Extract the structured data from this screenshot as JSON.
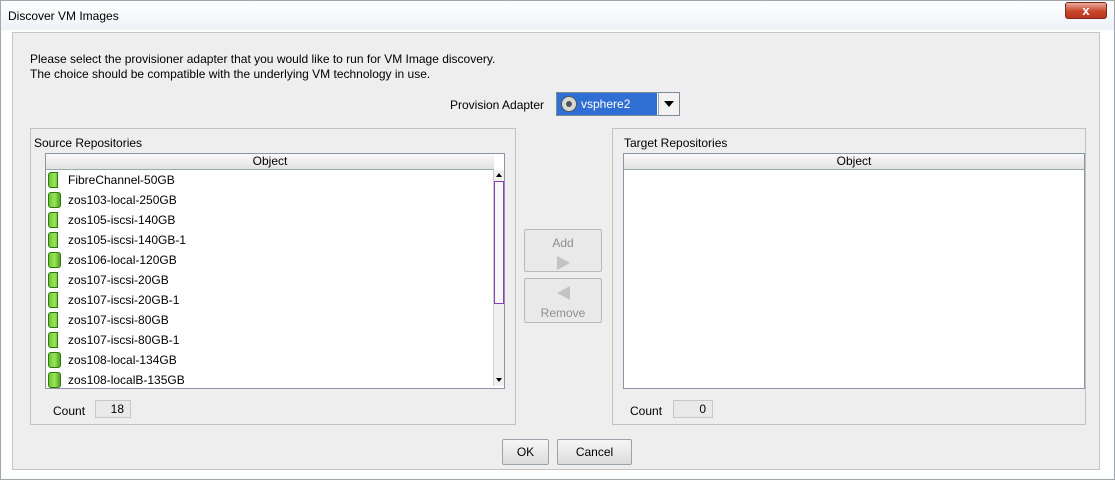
{
  "window": {
    "title": "Discover VM Images",
    "close_label": "x"
  },
  "intro": {
    "line1": "Please select the provisioner adapter that you would like to run for VM Image discovery.",
    "line2": "The choice should be compatible with the underlying VM technology in use."
  },
  "adapter": {
    "label": "Provision Adapter",
    "selected": "vsphere2",
    "icon": "gear-icon"
  },
  "source": {
    "title": "Source Repositories",
    "column": "Object",
    "count_label": "Count",
    "count": "18",
    "items": [
      {
        "name": "FibreChannel-50GB",
        "icon": "shared-datastore-icon"
      },
      {
        "name": "zos103-local-250GB",
        "icon": "datastore-icon"
      },
      {
        "name": "zos105-iscsi-140GB",
        "icon": "shared-datastore-icon"
      },
      {
        "name": "zos105-iscsi-140GB-1",
        "icon": "shared-datastore-icon"
      },
      {
        "name": "zos106-local-120GB",
        "icon": "datastore-icon"
      },
      {
        "name": "zos107-iscsi-20GB",
        "icon": "shared-datastore-icon"
      },
      {
        "name": "zos107-iscsi-20GB-1",
        "icon": "shared-datastore-icon"
      },
      {
        "name": "zos107-iscsi-80GB",
        "icon": "shared-datastore-icon"
      },
      {
        "name": "zos107-iscsi-80GB-1",
        "icon": "shared-datastore-icon"
      },
      {
        "name": "zos108-local-134GB",
        "icon": "datastore-icon"
      },
      {
        "name": "zos108-localB-135GB",
        "icon": "datastore-icon"
      }
    ]
  },
  "target": {
    "title": "Target Repositories",
    "column": "Object",
    "count_label": "Count",
    "count": "0"
  },
  "actions": {
    "add_label": "Add",
    "remove_label": "Remove"
  },
  "footer": {
    "ok_label": "OK",
    "cancel_label": "Cancel"
  }
}
